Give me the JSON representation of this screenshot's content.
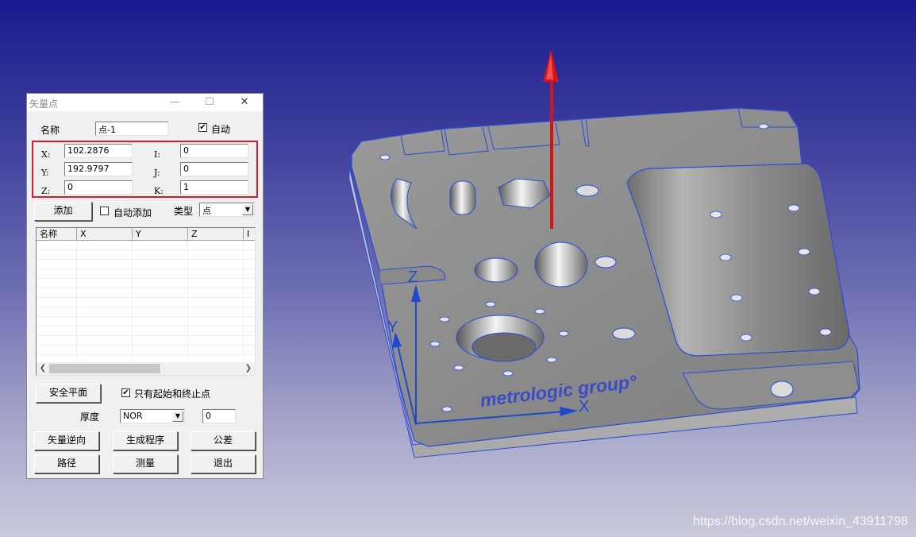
{
  "dialog": {
    "title": "矢量点",
    "window_buttons": {
      "minimize": "—",
      "maximize": "☐",
      "close": "✕"
    },
    "name_label": "名称",
    "name_value": "点-1",
    "auto_label": "自动",
    "auto_checked": true,
    "coords": {
      "x_label": "X:",
      "x_value": "102.2876",
      "y_label": "Y:",
      "y_value": "192.9797",
      "z_label": "Z:",
      "z_value": "0",
      "i_label": "I:",
      "i_value": "0",
      "j_label": "J:",
      "j_value": "0",
      "k_label": "K:",
      "k_value": "1"
    },
    "add_button": "添加",
    "auto_add_label": "自动添加",
    "auto_add_checked": false,
    "type_label": "类型",
    "type_value": "点",
    "table": {
      "columns": [
        "名称",
        "X",
        "Y",
        "Z",
        "I"
      ],
      "rows": []
    },
    "safe_plane_button": "安全平面",
    "only_start_end_label": "只有起始和终止点",
    "only_start_end_checked": true,
    "thickness_label": "厚度",
    "thickness_type": "NOR",
    "thickness_value": "0",
    "buttons": {
      "reverse_vector": "矢量逆向",
      "generate_program": "生成程序",
      "tolerance": "公差",
      "path": "路径",
      "measure": "测量",
      "exit": "退出"
    }
  },
  "viewport": {
    "part_logo": "metrologic group°",
    "axis_x": "X",
    "axis_y": "Y",
    "axis_z": "Z",
    "colors": {
      "background_top": "#1a1a8f",
      "background_bottom": "#cacadc",
      "part_gray": "#8c8c8c",
      "edge_blue": "#2a4bd8",
      "vector_red": "#d81414"
    }
  },
  "watermark": "https://blog.csdn.net/weixin_43911798"
}
